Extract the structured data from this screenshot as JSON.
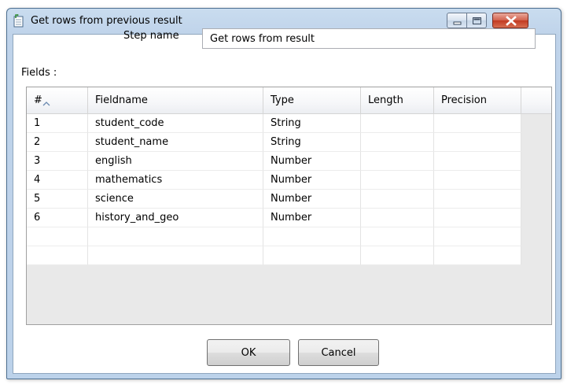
{
  "window": {
    "title": "Get rows from previous result"
  },
  "form": {
    "step_name_label": "Step name",
    "step_name_value": "Get rows from result",
    "fields_label": "Fields :"
  },
  "grid": {
    "columns": [
      "#",
      "Fieldname",
      "Type",
      "Length",
      "Precision"
    ],
    "rows": [
      [
        "1",
        "student_code",
        "String",
        "",
        ""
      ],
      [
        "2",
        "student_name",
        "String",
        "",
        ""
      ],
      [
        "3",
        "english",
        "Number",
        "",
        ""
      ],
      [
        "4",
        "mathematics",
        "Number",
        "",
        ""
      ],
      [
        "5",
        "science",
        "Number",
        "",
        ""
      ],
      [
        "6",
        "history_and_geo",
        "Number",
        "",
        ""
      ],
      [
        "",
        "",
        "",
        "",
        ""
      ],
      [
        "",
        "",
        "",
        "",
        ""
      ]
    ]
  },
  "buttons": {
    "ok": "OK",
    "cancel": "Cancel"
  },
  "icons": {
    "window": "step-icon",
    "minimize": "minimize-icon",
    "maximize": "maximize-icon",
    "close": "close-icon",
    "sort": "sort-ascending-icon"
  },
  "colors": {
    "frame": "#bfd3ea",
    "close_button": "#c23a22",
    "grid_background": "#e9e9e9"
  }
}
